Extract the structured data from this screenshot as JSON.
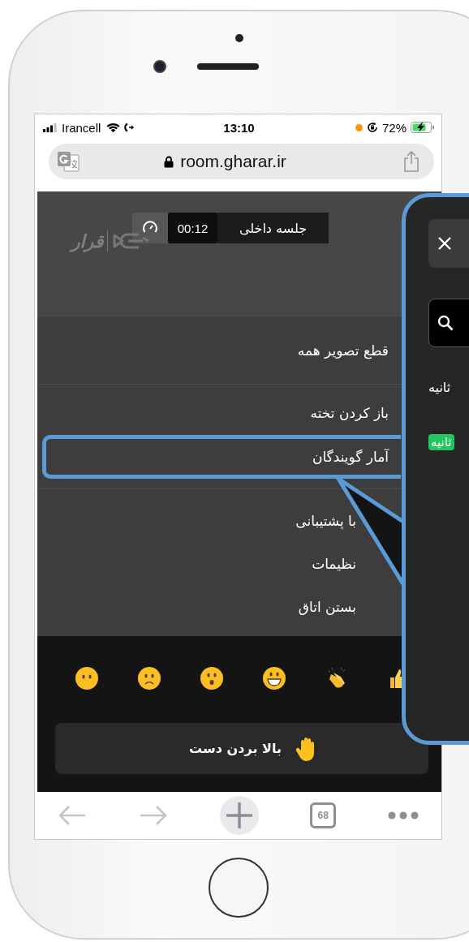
{
  "status_bar": {
    "carrier": "Irancell",
    "time": "13:10",
    "battery": "72%"
  },
  "address_bar": {
    "url": "room.gharar.ir"
  },
  "header": {
    "logo_text": "قرار",
    "timer": "00:12",
    "title": "جلسه داخلی"
  },
  "menu_groups": [
    {
      "items": [
        {
          "label": "قطع تصویر همه",
          "highlighted": false
        }
      ]
    },
    {
      "items": [
        {
          "label": "باز کردن تخته",
          "highlighted": false
        },
        {
          "label": "آمار گویندگان",
          "highlighted": true
        }
      ]
    },
    {
      "items": [
        {
          "label": "با پشتیبانی",
          "highlighted": false
        },
        {
          "label": "نظیمات",
          "highlighted": false
        },
        {
          "label": "بستن اتاق",
          "highlighted": false
        }
      ]
    }
  ],
  "raise_hand": {
    "label": "بالا بردن دست"
  },
  "toolbar": {
    "tab_count": "68"
  },
  "callout": {
    "rows": [
      {
        "kind": "plain",
        "text": "ثانیه"
      },
      {
        "kind": "badge",
        "text": "ثانیه"
      }
    ]
  }
}
